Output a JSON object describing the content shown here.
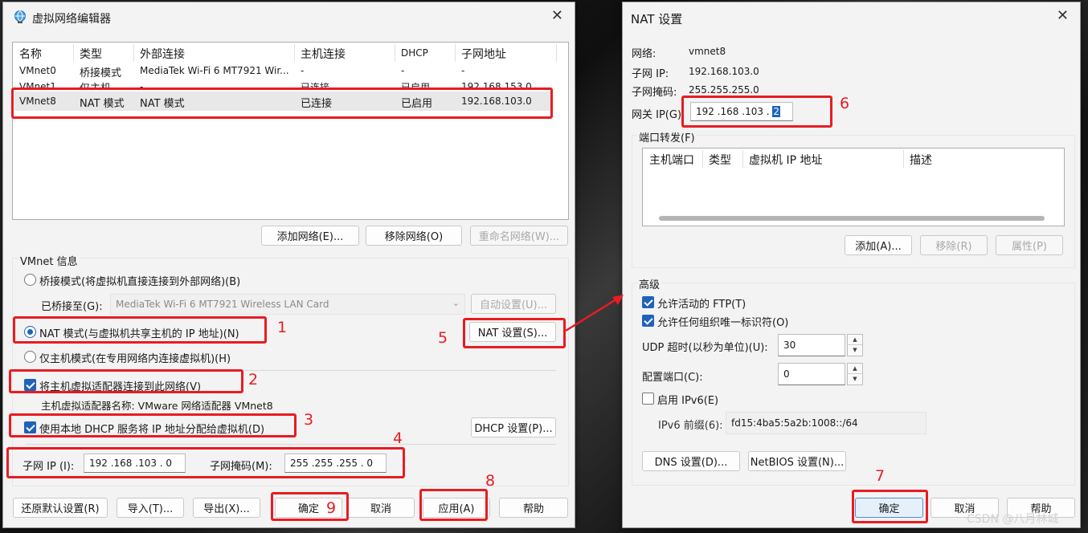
{
  "left_window": {
    "title": "虚拟网络编辑器",
    "columns": [
      "名称",
      "类型",
      "外部连接",
      "主机连接",
      "DHCP",
      "子网地址"
    ],
    "rows": [
      [
        "VMnet0",
        "桥接模式",
        "MediaTek Wi-Fi 6 MT7921 Wir...",
        "-",
        "-",
        "-"
      ],
      [
        "VMnet1",
        "仅主机...",
        "-",
        "已连接",
        "已启用",
        "192.168.153.0"
      ],
      [
        "VMnet8",
        "NAT 模式",
        "NAT 模式",
        "已连接",
        "已启用",
        "192.168.103.0"
      ]
    ],
    "buttons": {
      "add_network": "添加网络(E)...",
      "remove_network": "移除网络(O)",
      "rename_network": "重命名网络(W)..."
    },
    "info_label": "VMnet 信息",
    "bridge_mode": "桥接模式(将虚拟机直接连接到外部网络)(B)",
    "bridged_to_label": "已桥接至(G):",
    "bridged_to_value": "MediaTek Wi-Fi 6 MT7921 Wireless LAN Card",
    "auto_settings": "自动设置(U)...",
    "nat_mode": "NAT 模式(与虚拟机共享主机的 IP 地址)(N)",
    "nat_settings": "NAT 设置(S)...",
    "host_only_mode": "仅主机模式(在专用网络内连接虚拟机)(H)",
    "connect_adapter": "将主机虚拟适配器连接到此网络(V)",
    "adapter_name": "主机虚拟适配器名称: VMware 网络适配器 VMnet8",
    "use_dhcp": "使用本地 DHCP 服务将 IP 地址分配给虚拟机(D)",
    "dhcp_settings": "DHCP 设置(P)...",
    "subnet_ip_label": "子网 IP (I):",
    "subnet_ip_value": "192 .168 .103 .  0",
    "subnet_mask_label": "子网掩码(M):",
    "subnet_mask_value": "255 .255 .255 .  0",
    "bottom": {
      "restore": "还原默认设置(R)",
      "import": "导入(T)...",
      "export": "导出(X)...",
      "ok": "确定",
      "cancel": "取消",
      "apply": "应用(A)",
      "help": "帮助"
    }
  },
  "right_window": {
    "title": "NAT 设置",
    "network_label": "网络:",
    "network_value": "vmnet8",
    "subnet_ip_label": "子网 IP:",
    "subnet_ip_value": "192.168.103.0",
    "subnet_mask_label": "子网掩码:",
    "subnet_mask_value": "255.255.255.0",
    "gateway_label": "网关 IP(G):",
    "gateway_value": "192 .168 .103 . ",
    "gateway_last": "2",
    "port_forward_label": "端口转发(F)",
    "pf_columns": [
      "主机端口",
      "类型",
      "虚拟机 IP 地址",
      "描述"
    ],
    "pf_buttons": {
      "add": "添加(A)...",
      "remove": "移除(R)",
      "properties": "属性(P)"
    },
    "advanced_label": "高级",
    "allow_ftp": "允许活动的 FTP(T)",
    "allow_oui": "允许任何组织唯一标识符(O)",
    "udp_timeout_label": "UDP 超时(以秒为单位)(U):",
    "udp_timeout_value": "30",
    "config_port_label": "配置端口(C):",
    "config_port_value": "0",
    "enable_ipv6": "启用 IPv6(E)",
    "ipv6_prefix_label": "IPv6 前缀(6):",
    "ipv6_prefix_value": "fd15:4ba5:5a2b:1008::/64",
    "dns_settings": "DNS 设置(D)...",
    "netbios_settings": "NetBIOS 设置(N)...",
    "ok": "确定",
    "cancel": "取消",
    "help": "帮助"
  },
  "annotations": [
    "1",
    "2",
    "3",
    "4",
    "5",
    "6",
    "7",
    "8",
    "9"
  ],
  "watermark": "CSDN @八月林城",
  "colors": {
    "highlight_red": "#e81c22",
    "accent_blue": "#1f63b8"
  }
}
